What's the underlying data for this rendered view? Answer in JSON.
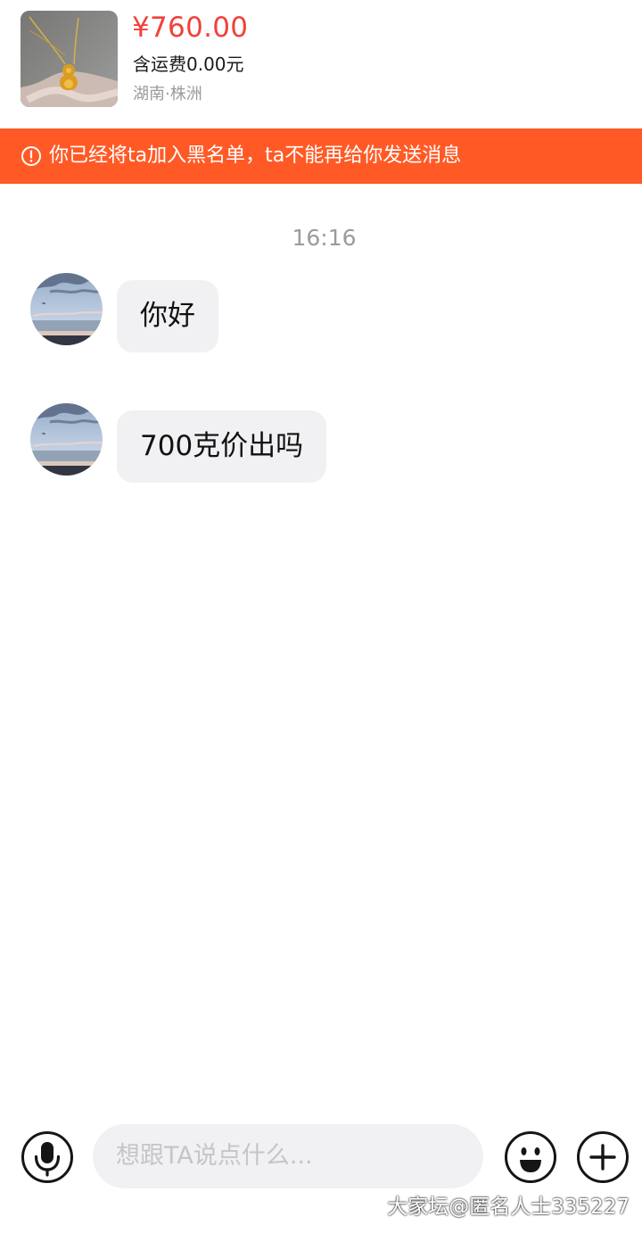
{
  "product": {
    "price": "¥760.00",
    "shipping": "含运费0.00元",
    "location": "湖南·株洲",
    "image_subject": "gold gourd pendant necklace"
  },
  "banner": {
    "icon": "exclamation-circle-icon",
    "text": "你已经将ta加入黑名单，ta不能再给你发送消息"
  },
  "chat": {
    "timestamp": "16:16",
    "messages": [
      {
        "text": "你好"
      },
      {
        "text": "700克价出吗"
      }
    ]
  },
  "input_bar": {
    "placeholder": "想跟TA说点什么...",
    "icons": [
      "microphone-icon",
      "emoji-icon",
      "plus-icon"
    ]
  },
  "watermark": "大家坛@匿名人士335227",
  "colors": {
    "price": "#f1413b",
    "banner": "#ff5a26",
    "bubble": "#f1f1f3"
  }
}
